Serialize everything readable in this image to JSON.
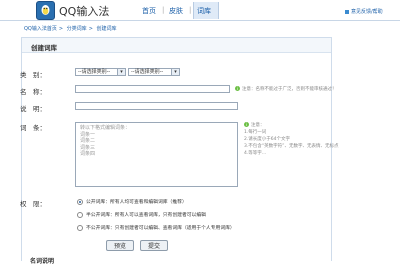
{
  "header": {
    "brand": "QQ输入法",
    "nav": [
      "首页",
      "皮肤",
      "词库"
    ],
    "active_nav": "词库",
    "top_link": "意见反馈/帮助"
  },
  "breadcrumb": [
    "QQ输入法首页",
    "分类词库",
    "创建词库"
  ],
  "panel": {
    "title": "创建词库",
    "category": {
      "label": "类　别：",
      "select1": "--请选择类别--",
      "select2": "--请选择类别--"
    },
    "name": {
      "label": "名　称：",
      "note": "注意：名称不能过于广泛，否则不能审核通过！"
    },
    "description": {
      "label": "说　明："
    },
    "entries": {
      "label": "词　条：",
      "placeholder_lines": [
        "转以下格式编辑词条：",
        "词条一",
        "词条二",
        "词条三",
        "词条四"
      ],
      "tips": [
        "注意：",
        "1.每行一词",
        "2.请长度小于64个文字",
        "3.不包含“英数字符”、无数字、无表情、无标点",
        "4.等等字…"
      ]
    },
    "permission": {
      "label": "权　限：",
      "options": [
        "公开词库：所有人均可查看和编辑词库（推荐）",
        "半公开词库：所有人可以查看词库，只有创建者可以编辑",
        "不公开词库：只有创建者可以编辑、查看词库（适用于个人专用词库）"
      ],
      "selected": 0
    },
    "buttons": {
      "preview": "预览",
      "submit": "提交"
    },
    "footer_title": "名词说明"
  }
}
